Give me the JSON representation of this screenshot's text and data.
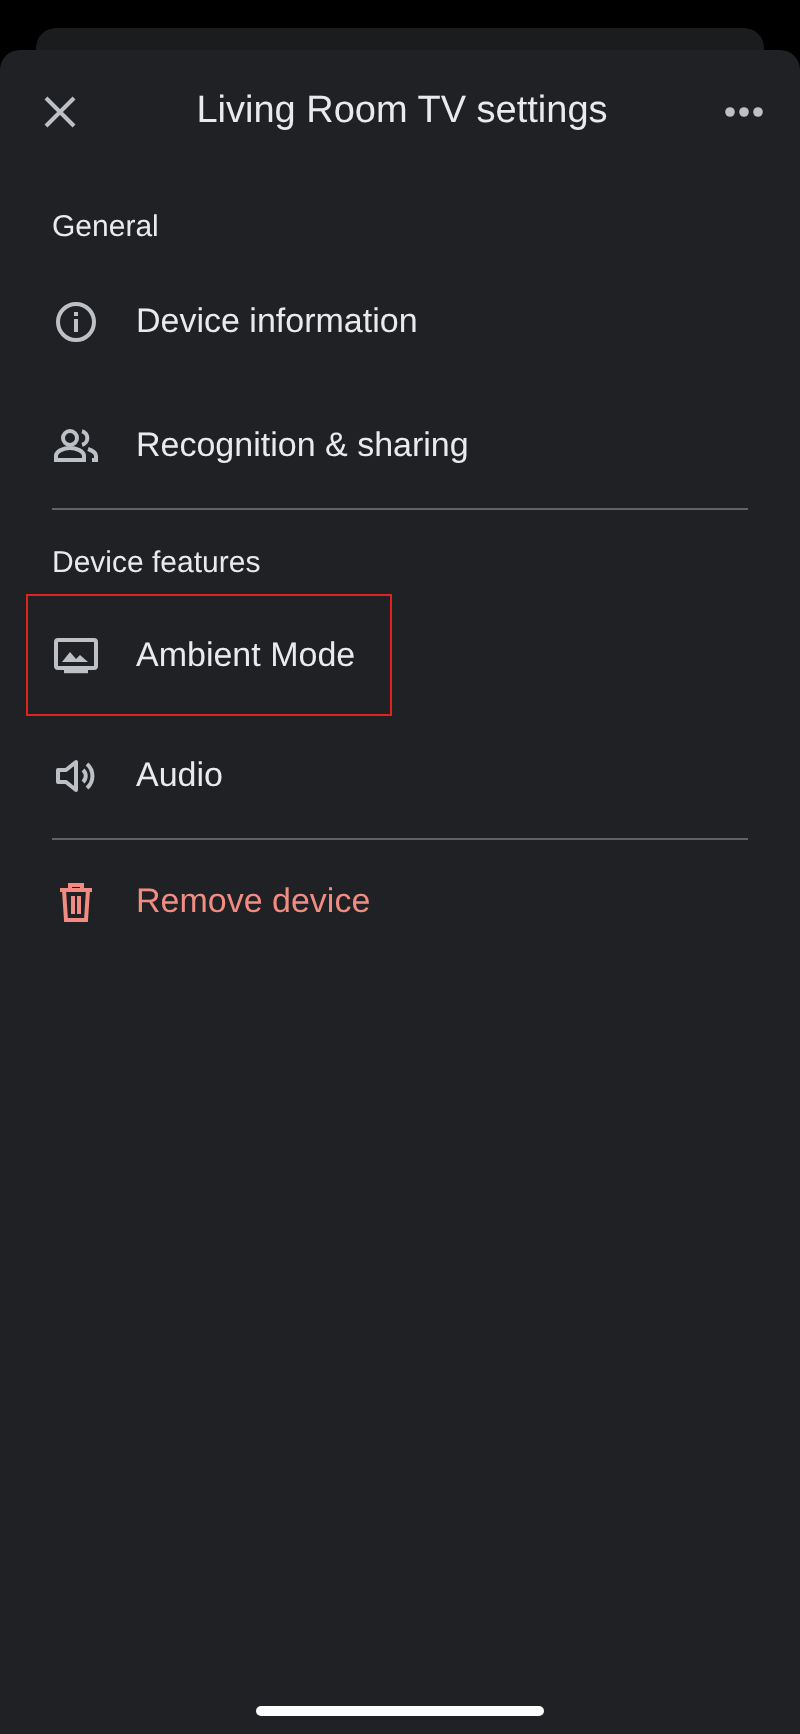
{
  "header": {
    "title": "Living Room TV settings"
  },
  "sections": [
    {
      "title": "General",
      "items": [
        {
          "kind": "info",
          "label": "Device information",
          "highlighted": false,
          "destructive": false
        },
        {
          "kind": "people",
          "label": "Recognition & sharing",
          "highlighted": false,
          "destructive": false
        }
      ]
    },
    {
      "title": "Device features",
      "items": [
        {
          "kind": "frame",
          "label": "Ambient Mode",
          "highlighted": true,
          "destructive": false
        },
        {
          "kind": "speaker",
          "label": "Audio",
          "highlighted": false,
          "destructive": false
        }
      ]
    },
    {
      "items": [
        {
          "kind": "trash",
          "label": "Remove device",
          "highlighted": false,
          "destructive": true
        }
      ]
    }
  ]
}
